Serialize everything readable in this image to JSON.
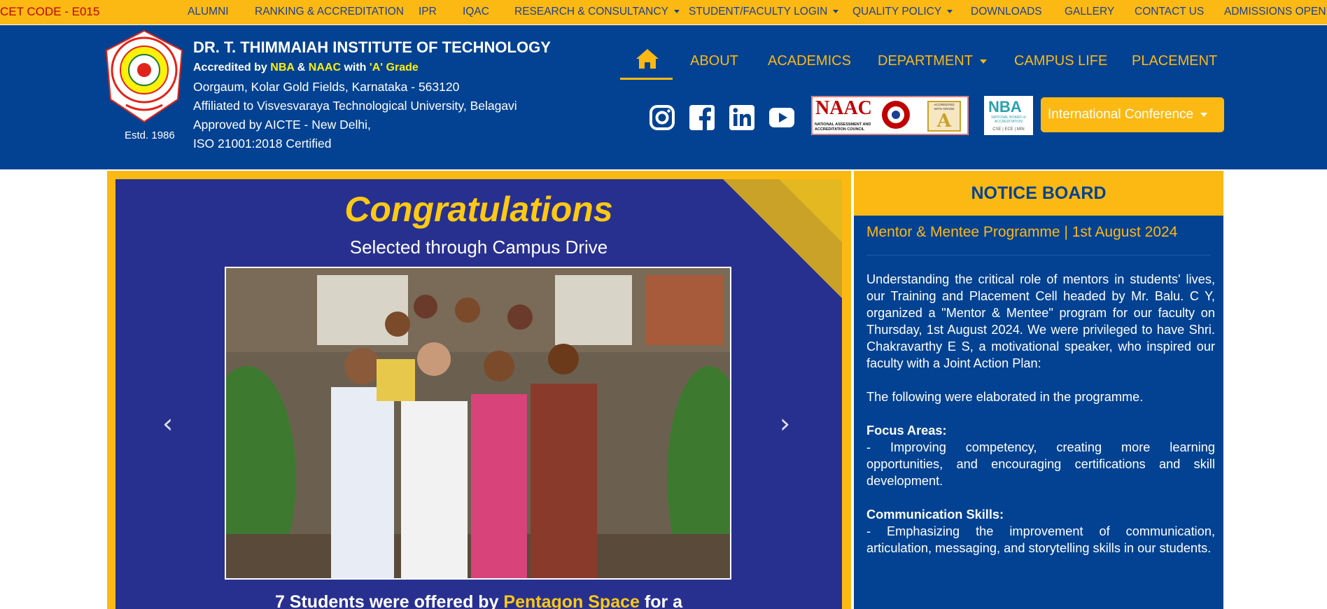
{
  "topbar": {
    "cet_code": "CET CODE - E015",
    "links": [
      {
        "label": "ALUMNI"
      },
      {
        "label": "RANKING & ACCREDITATION"
      },
      {
        "label": "IPR"
      },
      {
        "label": "IQAC"
      },
      {
        "label": "RESEARCH & CONSULTANCY"
      },
      {
        "label": "STUDENT/FACULTY LOGIN"
      },
      {
        "label": "QUALITY POLICY"
      },
      {
        "label": "DOWNLOADS"
      },
      {
        "label": "GALLERY"
      },
      {
        "label": "CONTACT US"
      },
      {
        "label": "ADMISSIONS OPEN"
      }
    ]
  },
  "header": {
    "estd": "Estd. 1986",
    "institute_name": "DR. T. THIMMAIAH INSTITUTE OF TECHNOLOGY",
    "accreditation": {
      "prefix": "Accredited by ",
      "nba": "NBA",
      "amp": " & ",
      "naac": "NAAC",
      "with": " with ",
      "grade": "'A' Grade"
    },
    "address_lines": [
      "Oorgaum, Kolar Gold Fields, Karnataka - 563120",
      "Affiliated to Visvesvaraya Technological University, Belagavi",
      "Approved by AICTE - New Delhi,",
      "ISO 21001:2018 Certified"
    ],
    "nav": {
      "about": "ABOUT",
      "academics": "ACADEMICS",
      "department": "DEPARTMENT",
      "campus_life": "CAMPUS LIFE",
      "placement": "PLACEMENT"
    },
    "social_icons": [
      "instagram-icon",
      "facebook-icon",
      "linkedin-icon",
      "youtube-icon"
    ],
    "conference_button": "International Conference",
    "naac_logo": {
      "name": "NAAC",
      "caption": "NATIONAL ASSESSMENT AND ACCREDITATION COUNCIL",
      "badge": "ACCREDITED WITH GRADE"
    },
    "nba_logo": {
      "name": "NBA",
      "caption": "NATIONAL BOARD of ACCREDITATION",
      "depts": "CSE | ECE | MIN"
    }
  },
  "colors": {
    "accent_yellow": "#fdb913",
    "header_blue": "#034292",
    "slide_blue": "#28308f",
    "cet_red": "#c00000"
  },
  "slide": {
    "heading": "Congratulations",
    "subheading": "Selected through Campus Drive",
    "caption_start": "7 Students were offered by ",
    "caption_company": "Pentagon Space",
    "caption_end": " for a"
  },
  "notice_board": {
    "title": "NOTICE BOARD",
    "item_title": "Mentor & Mentee Programme | 1st August 2024",
    "intro": "Understanding the critical role of mentors in students' lives, our Training and Placement Cell headed by Mr. Balu. C Y, organized a \"Mentor & Mentee\" program for our faculty on Thursday, 1st August 2024. We were privileged to have Shri. Chakravarthy E S, a motivational speaker, who inspired our faculty with a Joint Action Plan:",
    "elaborated": "The following were elaborated in the programme.",
    "focus_heading": "Focus Areas:",
    "focus_text": "- Improving competency, creating more learning opportunities, and encouraging certifications and skill development.",
    "comm_heading": "Communication Skills:",
    "comm_text": "- Emphasizing the improvement of communication, articulation, messaging, and storytelling skills in our students."
  }
}
